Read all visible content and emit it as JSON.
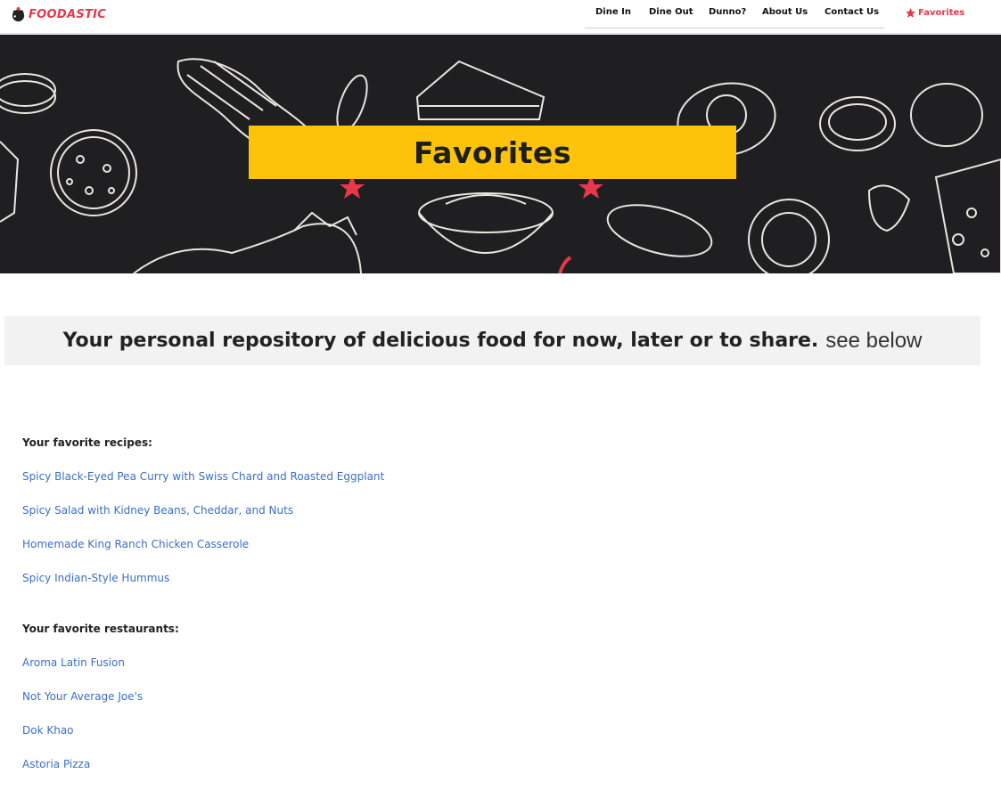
{
  "brand": {
    "logo_text": "FOODASTIC"
  },
  "nav": {
    "items": [
      {
        "label": "Dine In"
      },
      {
        "label": "Dine Out"
      },
      {
        "label": "Dunno?"
      },
      {
        "label": "About Us"
      },
      {
        "label": "Contact Us"
      }
    ],
    "favorites_label": "Favorites"
  },
  "hero": {
    "title": "Favorites"
  },
  "tagline": {
    "bold": "Your personal repository of delicious food for now, later or to share.",
    "light": "see below"
  },
  "recipes": {
    "heading": "Your favorite recipes:",
    "items": [
      "Spicy Black-Eyed Pea Curry with Swiss Chard and Roasted Eggplant",
      "Spicy Salad with Kidney Beans, Cheddar, and Nuts",
      "Homemade King Ranch Chicken Casserole",
      "Spicy Indian-Style Hummus"
    ]
  },
  "restaurants": {
    "heading": "Your favorite restaurants:",
    "items": [
      "Aroma Latin Fusion",
      "Not Your Average Joe's",
      "Dok Khao",
      "Astoria Pizza"
    ]
  },
  "colors": {
    "accent": "#e8384a",
    "banner": "#fcc30a",
    "link": "#3a6fc4",
    "hero_bg": "#1f1f21"
  }
}
